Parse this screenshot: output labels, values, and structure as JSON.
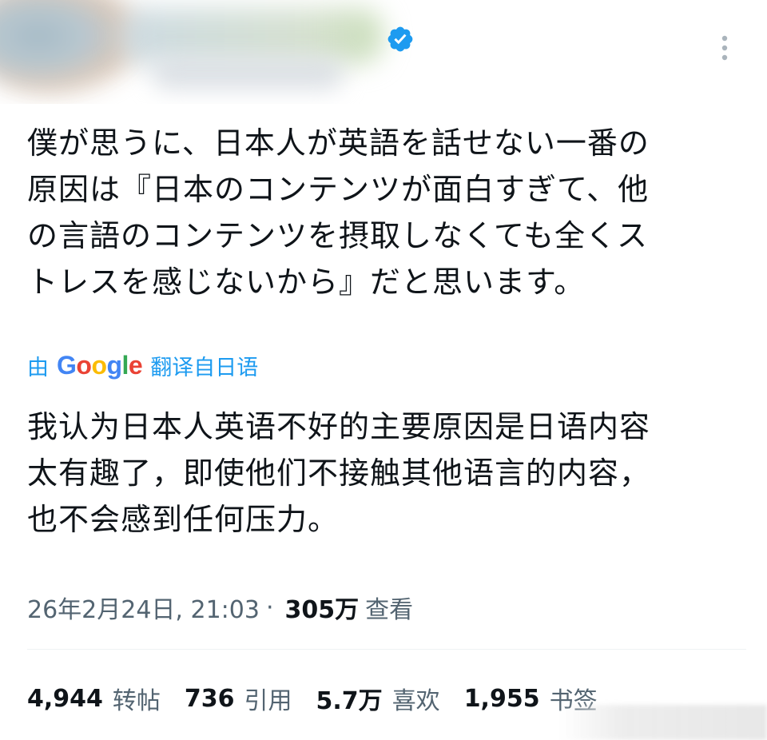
{
  "tweet": {
    "more_icon": "more-vertical-icon",
    "verified_icon": "verified-badge-icon",
    "verified_color": "#1d9bf0",
    "text_lines": [
      "僕が思うに、日本人が英語を話せない一番の",
      "原因は『日本のコンテンツが面白すぎて、他",
      "の言語のコンテンツを摂取しなくても全くス",
      "トレスを感じないから』だと思います。"
    ]
  },
  "translation": {
    "prefix": "由",
    "provider": "Google",
    "suffix": "翻译自日语",
    "link_color": "#1d9bf0",
    "text_lines": [
      "我认为日本人英语不好的主要原因是日语内容",
      "太有趣了，即使他们不接触其他语言的内容，",
      "也不会感到任何压力。"
    ]
  },
  "meta": {
    "timestamp": "26年2月24日, 21:03",
    "separator": "·",
    "views_count": "305万",
    "views_label": "查看"
  },
  "stats": {
    "reposts_count": "4,944",
    "reposts_label": "转帖",
    "quotes_count": "736",
    "quotes_label": "引用",
    "likes_count": "5.7万",
    "likes_label": "喜欢",
    "bookmarks_count": "1,955",
    "bookmarks_label": "书签"
  }
}
